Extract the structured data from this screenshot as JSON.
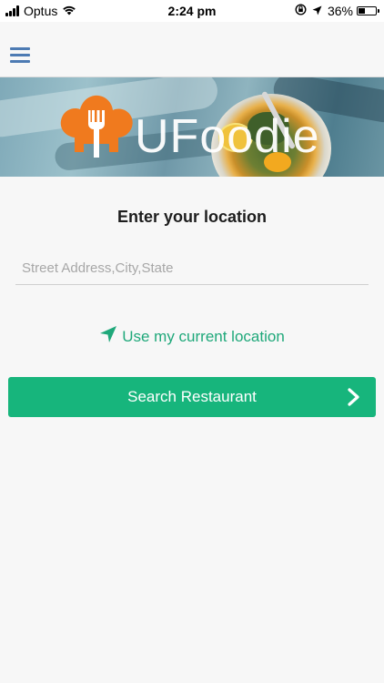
{
  "status_bar": {
    "carrier": "Optus",
    "time": "2:24 pm",
    "battery_percent": "36%",
    "battery_level": 0.36
  },
  "banner": {
    "logo_text": "UFoodie"
  },
  "main": {
    "title": "Enter your location",
    "address_placeholder": "Street Address,City,State",
    "current_location_label": "Use my current location",
    "search_button_label": "Search Restaurant"
  },
  "colors": {
    "accent_green": "#17b57c",
    "link_green": "#1fa87a",
    "menu_blue": "#4d7bb3",
    "logo_orange": "#f07a1e"
  },
  "icons": {
    "menu": "hamburger-menu-icon",
    "location": "navigation-arrow-icon",
    "search_chevron": "chevron-right-icon",
    "logo": "chef-hat-fork-icon"
  }
}
